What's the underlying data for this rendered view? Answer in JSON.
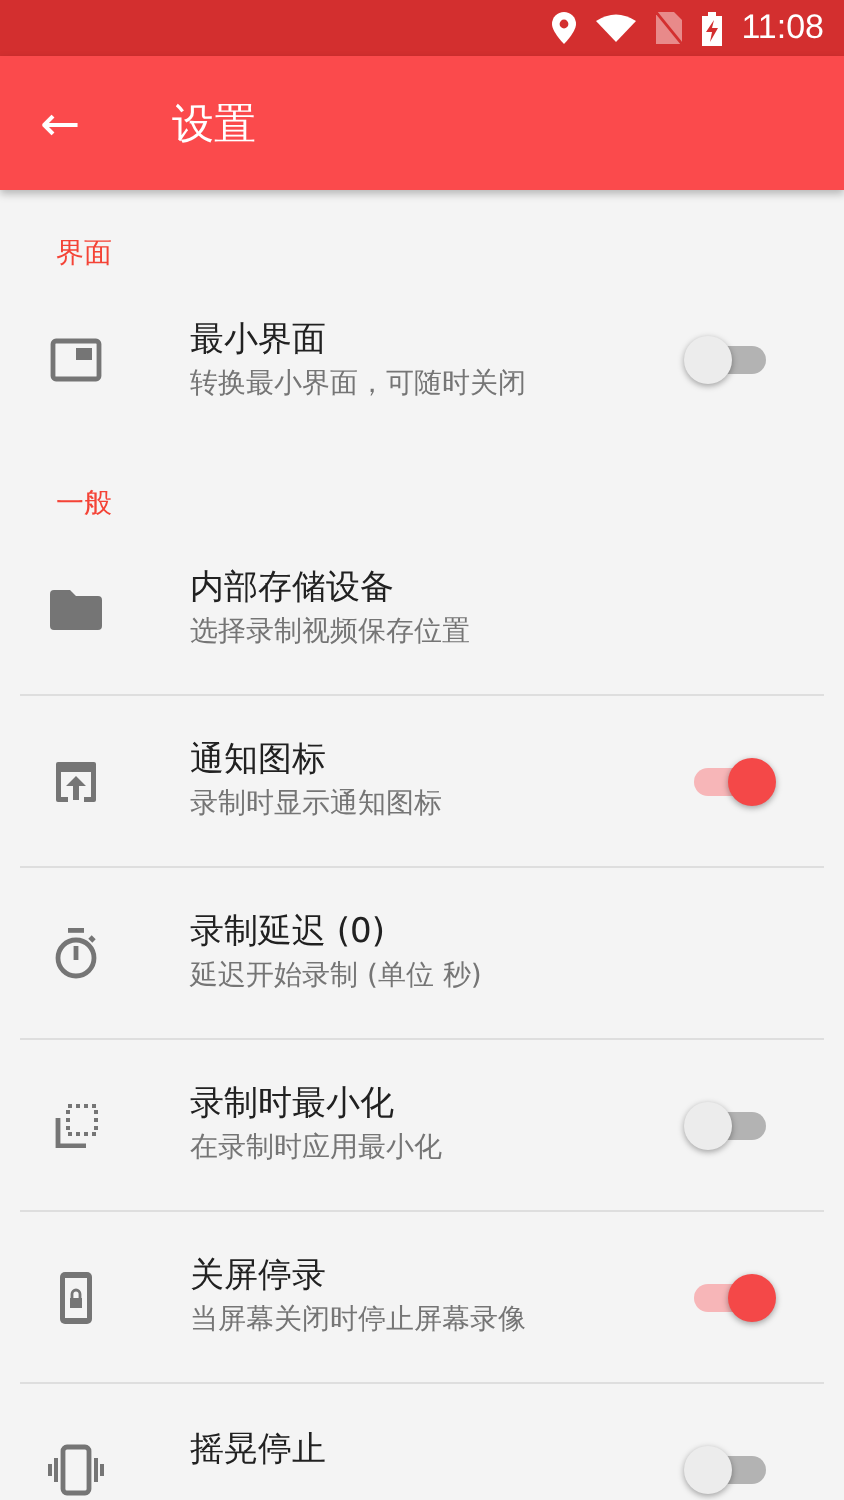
{
  "status_bar": {
    "time": "11:08"
  },
  "app_bar": {
    "back_icon": "←",
    "title": "设置"
  },
  "sections": [
    {
      "header": "界面",
      "items": [
        {
          "kind": "toggle",
          "title": "最小界面",
          "subtitle": "转换最小界面，可随时关闭",
          "on": false
        }
      ]
    },
    {
      "header": "一般",
      "items": [
        {
          "kind": "plain",
          "title": "内部存储设备",
          "subtitle": "选择录制视频保存位置"
        },
        {
          "kind": "toggle",
          "title": "通知图标",
          "subtitle": "录制时显示通知图标",
          "on": true
        },
        {
          "kind": "plain",
          "title": "录制延迟 (0)",
          "subtitle": "延迟开始录制 (单位 秒)"
        },
        {
          "kind": "toggle",
          "title": "录制时最小化",
          "subtitle": "在录制时应用最小化",
          "on": false
        },
        {
          "kind": "toggle",
          "title": "关屏停录",
          "subtitle": "当屏幕关闭时停止屏幕录像",
          "on": true
        },
        {
          "kind": "toggle",
          "title": "摇晃停止",
          "on": false
        }
      ]
    }
  ]
}
